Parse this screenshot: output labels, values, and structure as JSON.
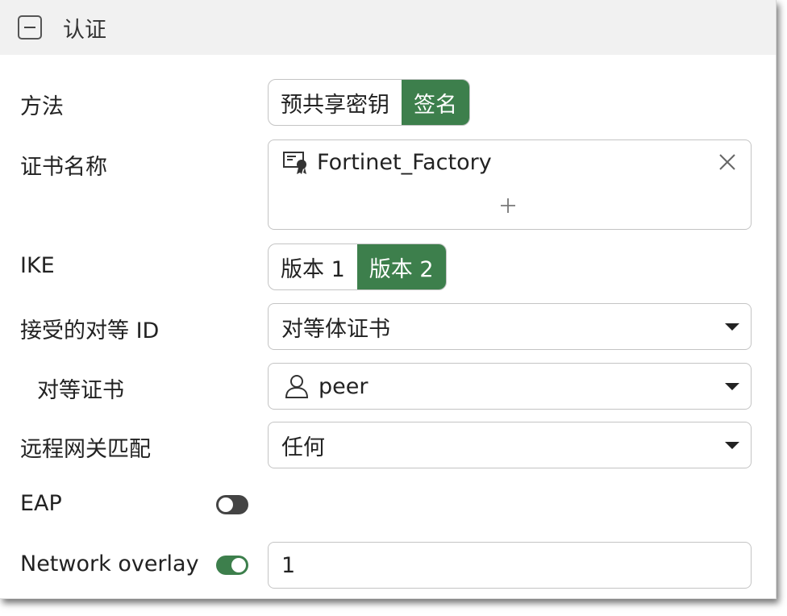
{
  "section": {
    "title": "认证",
    "icon": "collapse-minus-icon"
  },
  "method": {
    "label": "方法",
    "options": [
      "预共享密钥",
      "签名"
    ],
    "selected": "签名"
  },
  "certificate": {
    "label": "证书名称",
    "value": "Fortinet_Factory",
    "icon": "certificate-icon"
  },
  "ike": {
    "label": "IKE",
    "options": [
      "版本 1",
      "版本 2"
    ],
    "selected": "版本 2"
  },
  "accept_peer_id": {
    "label": "接受的对等 ID",
    "value": "对等体证书"
  },
  "peer_cert": {
    "label": "对等证书",
    "value": "peer",
    "icon": "user-icon"
  },
  "remote_gw_match": {
    "label": "远程网关匹配",
    "value": "任何"
  },
  "eap": {
    "label": "EAP",
    "enabled": false
  },
  "network_overlay": {
    "label": "Network overlay",
    "enabled": true,
    "value": "1"
  },
  "colors": {
    "accent": "#3d7f4c",
    "toggle_off": "#444444"
  }
}
